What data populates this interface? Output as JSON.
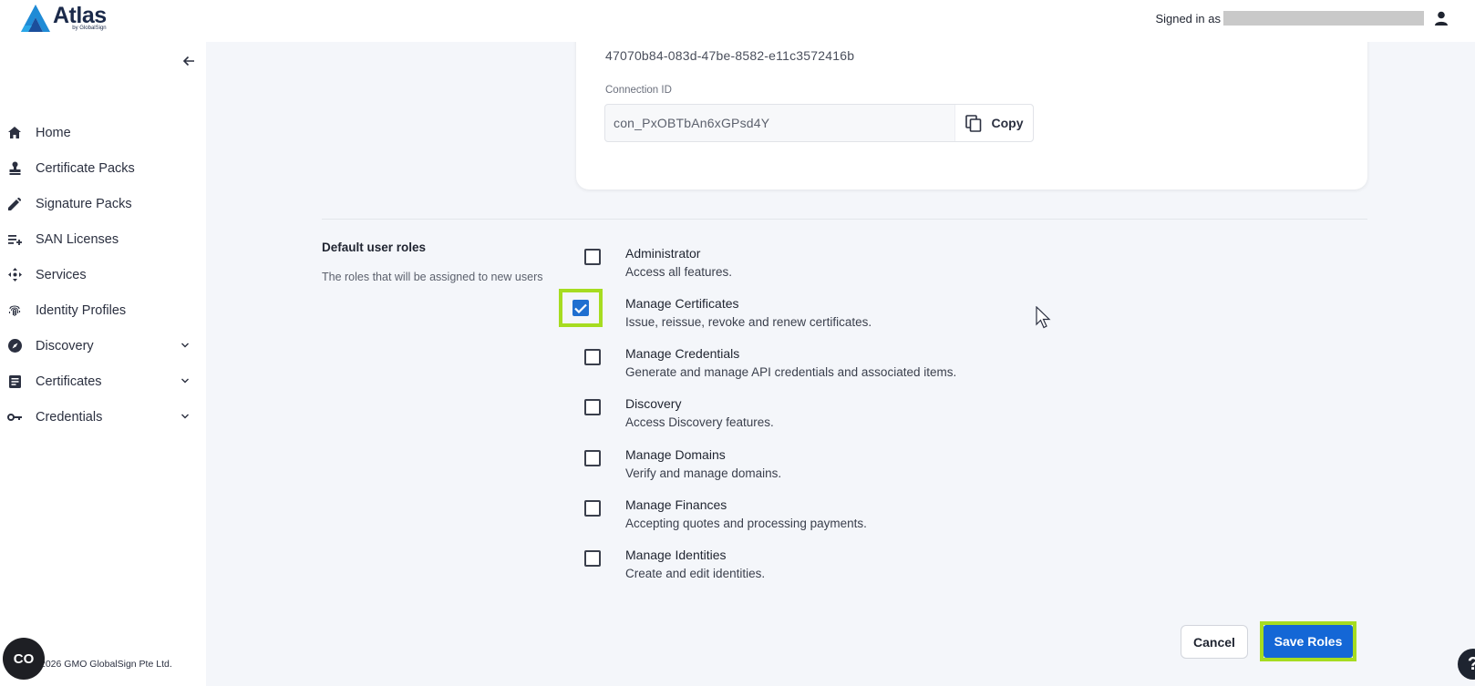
{
  "header": {
    "logo_title": "Atlas",
    "logo_sub": "by GlobalSign",
    "signed_in_label": "Signed in as"
  },
  "sidebar": {
    "items": [
      {
        "label": "Home",
        "icon": "home-icon"
      },
      {
        "label": "Certificate Packs",
        "icon": "stamp-icon"
      },
      {
        "label": "Signature Packs",
        "icon": "pen-icon"
      },
      {
        "label": "SAN Licenses",
        "icon": "playlist-add-icon"
      },
      {
        "label": "Services",
        "icon": "move-icon"
      },
      {
        "label": "Identity Profiles",
        "icon": "fingerprint-icon"
      },
      {
        "label": "Discovery",
        "icon": "compass-icon",
        "expandable": true
      },
      {
        "label": "Certificates",
        "icon": "document-icon",
        "expandable": true
      },
      {
        "label": "Credentials",
        "icon": "key-icon",
        "expandable": true
      }
    ],
    "footer": "2026 GMO GlobalSign Pte Ltd.",
    "badge_text": "CO"
  },
  "connection": {
    "id_value": "47070b84-083d-47be-8582-e11c3572416b",
    "connection_label": "Connection ID",
    "connection_value": "con_PxOBTbAn6xGPsd4Y",
    "copy_label": "Copy"
  },
  "roles_section": {
    "title": "Default user roles",
    "description": "The roles that will be assigned to new users",
    "roles": [
      {
        "name": "Administrator",
        "description": "Access all features.",
        "checked": false
      },
      {
        "name": "Manage Certificates",
        "description": "Issue, reissue, revoke and renew certificates.",
        "checked": true
      },
      {
        "name": "Manage Credentials",
        "description": "Generate and manage API credentials and associated items.",
        "checked": false
      },
      {
        "name": "Discovery",
        "description": "Access Discovery features.",
        "checked": false
      },
      {
        "name": "Manage Domains",
        "description": "Verify and manage domains.",
        "checked": false
      },
      {
        "name": "Manage Finances",
        "description": "Accepting quotes and processing payments.",
        "checked": false
      },
      {
        "name": "Manage Identities",
        "description": "Create and edit identities.",
        "checked": false
      }
    ]
  },
  "actions": {
    "cancel_label": "Cancel",
    "save_label": "Save Roles",
    "help_label": "?"
  },
  "colors": {
    "accent": "#1467d6",
    "highlight": "#a6dc20",
    "checkbox_checked": "#1f6fd0"
  }
}
